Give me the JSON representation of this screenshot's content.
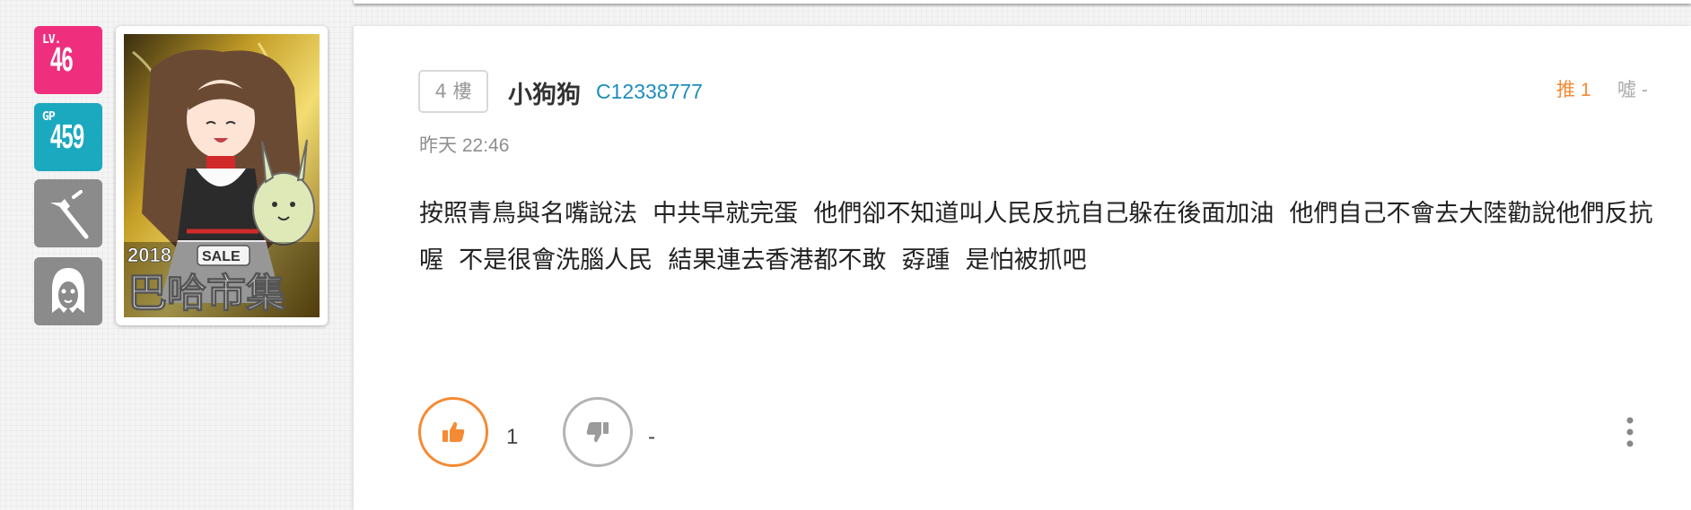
{
  "sidebar": {
    "level": {
      "prefix": "LV.",
      "value": "46",
      "color": "#f02e7e"
    },
    "gp": {
      "prefix": "GP",
      "value": "459",
      "color": "#1ba9c0"
    },
    "tool_icon": "wrench-tool-icon",
    "ghost_icon": "ghost-mask-icon",
    "avatar": {
      "year_text": "2018",
      "sale_text": "SALE",
      "banner_text": "巴哈市集"
    }
  },
  "post": {
    "floor": "4 樓",
    "username": "小狗狗",
    "user_id": "C12338777",
    "timestamp": "昨天 22:46",
    "gp_label": "推 1",
    "bp_label": "噓 -",
    "content": "按照青鳥與名嘴說法  中共早就完蛋  他們卻不知道叫人民反抗自己躲在後面加油  他們自己不會去大陸勸說他們反抗喔  不是很會洗腦人民  結果連去香港都不敢  孬踵  是怕被抓吧"
  },
  "actions": {
    "like_count": "1",
    "dislike_count": "-",
    "like_color": "#f58a34",
    "dislike_color": "#b3b3b3"
  }
}
